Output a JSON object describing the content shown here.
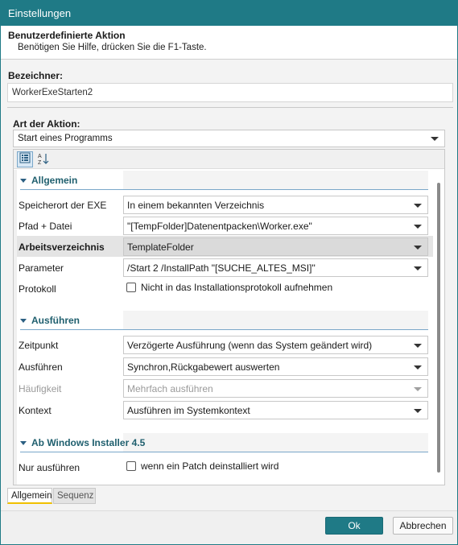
{
  "window": {
    "title": "Einstellungen"
  },
  "header": {
    "title": "Benutzerdefinierte Aktion",
    "subtitle": "Benötigen Sie Hilfe, drücken Sie die F1-Taste."
  },
  "identifier": {
    "label": "Bezeichner:",
    "value": "WorkerExeStarten2"
  },
  "action_type": {
    "label": "Art der Aktion:",
    "value": "Start eines Programms"
  },
  "toolbar": {
    "categorized_icon": "categorized-view-icon",
    "alpha_icon": "sort-alphabetical-icon"
  },
  "categories": [
    {
      "label": "Allgemein",
      "rows": [
        {
          "name": "Speicherort der EXE",
          "value": "In einem bekannten Verzeichnis",
          "type": "combo"
        },
        {
          "name": "Pfad + Datei",
          "value": "\"[TempFolder]Datenentpacken\\Worker.exe\"",
          "type": "combo"
        },
        {
          "name": "Arbeitsverzeichnis",
          "value": "TemplateFolder",
          "type": "combo",
          "selected": true
        },
        {
          "name": "Parameter",
          "value": "/Start 2 /InstallPath \"[SUCHE_ALTES_MSI]\"",
          "type": "combo"
        },
        {
          "name": "Protokoll",
          "value": "Nicht in das Installationsprotokoll aufnehmen",
          "type": "check",
          "checked": false
        }
      ]
    },
    {
      "label": "Ausführen",
      "rows": [
        {
          "name": "Zeitpunkt",
          "value": "Verzögerte Ausführung (wenn das System geändert wird)",
          "type": "combo"
        },
        {
          "name": "Ausführen",
          "value": "Synchron,Rückgabewert auswerten",
          "type": "combo"
        },
        {
          "name": "Häufigkeit",
          "value": "Mehrfach ausführen",
          "type": "combo",
          "disabled": true
        },
        {
          "name": "Kontext",
          "value": "Ausführen im Systemkontext",
          "type": "combo"
        }
      ]
    },
    {
      "label": "Ab Windows Installer 4.5",
      "rows": [
        {
          "name": "Nur ausführen",
          "value": "wenn ein Patch deinstalliert wird",
          "type": "check",
          "checked": false
        }
      ]
    }
  ],
  "tabs": [
    {
      "label": "Allgemein",
      "active": true
    },
    {
      "label": "Sequenz",
      "active": false
    }
  ],
  "buttons": {
    "ok": "Ok",
    "cancel": "Abbrechen"
  },
  "colors": {
    "accent": "#1f7a86",
    "category_text": "#1f5f6e"
  }
}
